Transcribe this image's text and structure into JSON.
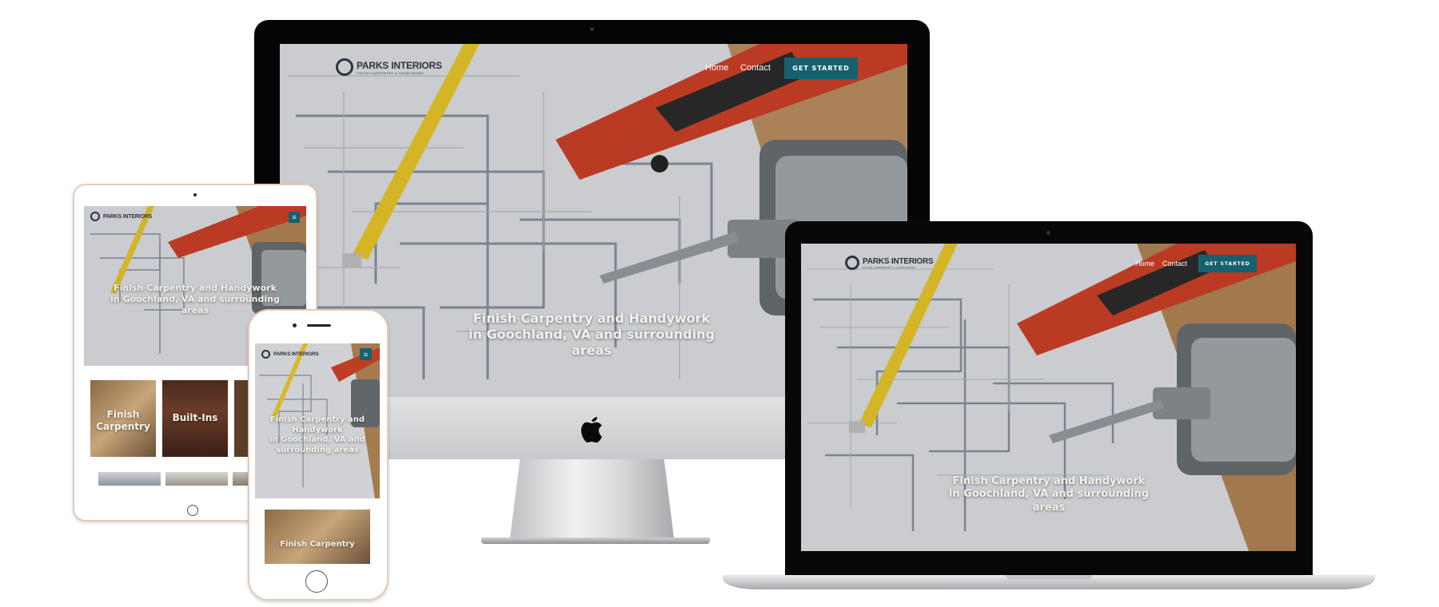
{
  "site": {
    "brand_name": "PARKS INTERIORS",
    "brand_tagline": "FINISH CARPENTRY & HANDYWORK",
    "nav_home": "Home",
    "nav_contact": "Contact",
    "cta_label": "GET STARTED",
    "hero_line1": "Finish Carpentry and Handywork",
    "hero_line2": "in Goochland, VA and surrounding areas",
    "hero_phone_l1": "Finish Carpentry and",
    "hero_phone_l2": "Handywork",
    "hero_phone_l3": "in Goochland, VA and",
    "hero_phone_l4": "surrounding areas"
  },
  "services": {
    "finish_carpentry": "Finish Carpentry",
    "finish_l1": "Finish",
    "finish_l2": "Carpentry",
    "built_ins": "Built-Ins"
  },
  "colors": {
    "accent": "#17606f",
    "wood": "#b98a55",
    "paper": "#e9ebef",
    "tape": "#f1cf2c",
    "level_red": "#d5432a"
  },
  "icons": {
    "apple": "apple-logo-icon",
    "menu": "hamburger-menu-icon"
  }
}
